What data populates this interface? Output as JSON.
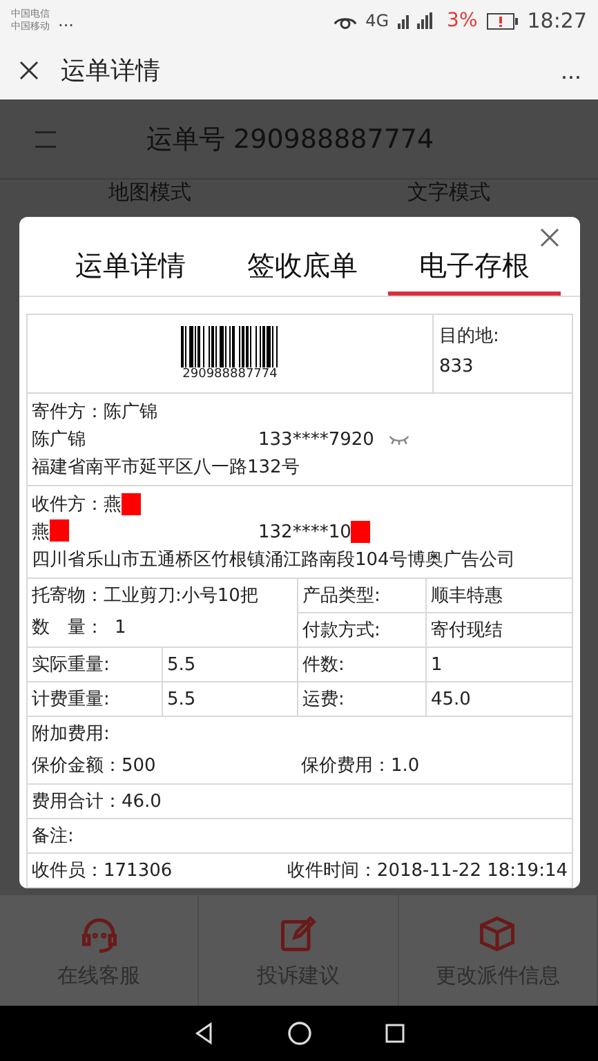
{
  "status_bar": {
    "carriers": [
      "中国电信",
      "中国移动"
    ],
    "more": "...",
    "network": "4G",
    "battery": "3%",
    "time": "18:27"
  },
  "nav_bar": {
    "title": "运单详情",
    "more": "..."
  },
  "page": {
    "waybill_title": "运单号 290988887774",
    "view_tabs": [
      "地图模式",
      "文字模式"
    ]
  },
  "modal": {
    "tabs": [
      {
        "label": "运单详情",
        "selected": false
      },
      {
        "label": "签收底单",
        "selected": false
      },
      {
        "label": "电子存根",
        "selected": true
      }
    ],
    "barcode_number": "290988887774",
    "destination_label": "目的地:",
    "destination_value": "833",
    "sender": {
      "title": "寄件方：陈广锦",
      "name": "陈广锦",
      "phone": "133****7920",
      "address": "福建省南平市延平区八一路132号"
    },
    "recipient": {
      "title": "收件方：燕",
      "name": "燕",
      "phone": "132****10",
      "address": "四川省乐山市五通桥区竹根镇涌江路南段104号博奥广告公司"
    },
    "goods": "托寄物：工业剪刀:小号10把",
    "quantity_label": "数　量：",
    "quantity": "1",
    "fields": [
      {
        "label": "产品类型:",
        "value": "顺丰特惠"
      },
      {
        "label": "付款方式:",
        "value": "寄付现结"
      }
    ],
    "weights": [
      {
        "label": "实际重量:",
        "value": "5.5",
        "label2": "件数:",
        "value2": "1"
      },
      {
        "label": "计费重量:",
        "value": "5.5",
        "label2": "运费:",
        "value2": "45.0"
      }
    ],
    "extra_fee_label": "附加费用:",
    "insured_amount": "保价金额：500",
    "insured_fee": "保价费用：1.0",
    "total": "费用合计：46.0",
    "remark": "备注:",
    "collector": "收件员：171306",
    "collect_time": "收件时间：2018-11-22 18:19:14"
  },
  "actions": [
    {
      "kind": "headset",
      "label": "在线客服"
    },
    {
      "kind": "edit",
      "label": "投诉建议"
    },
    {
      "kind": "box",
      "label": "更改派件信息"
    }
  ]
}
